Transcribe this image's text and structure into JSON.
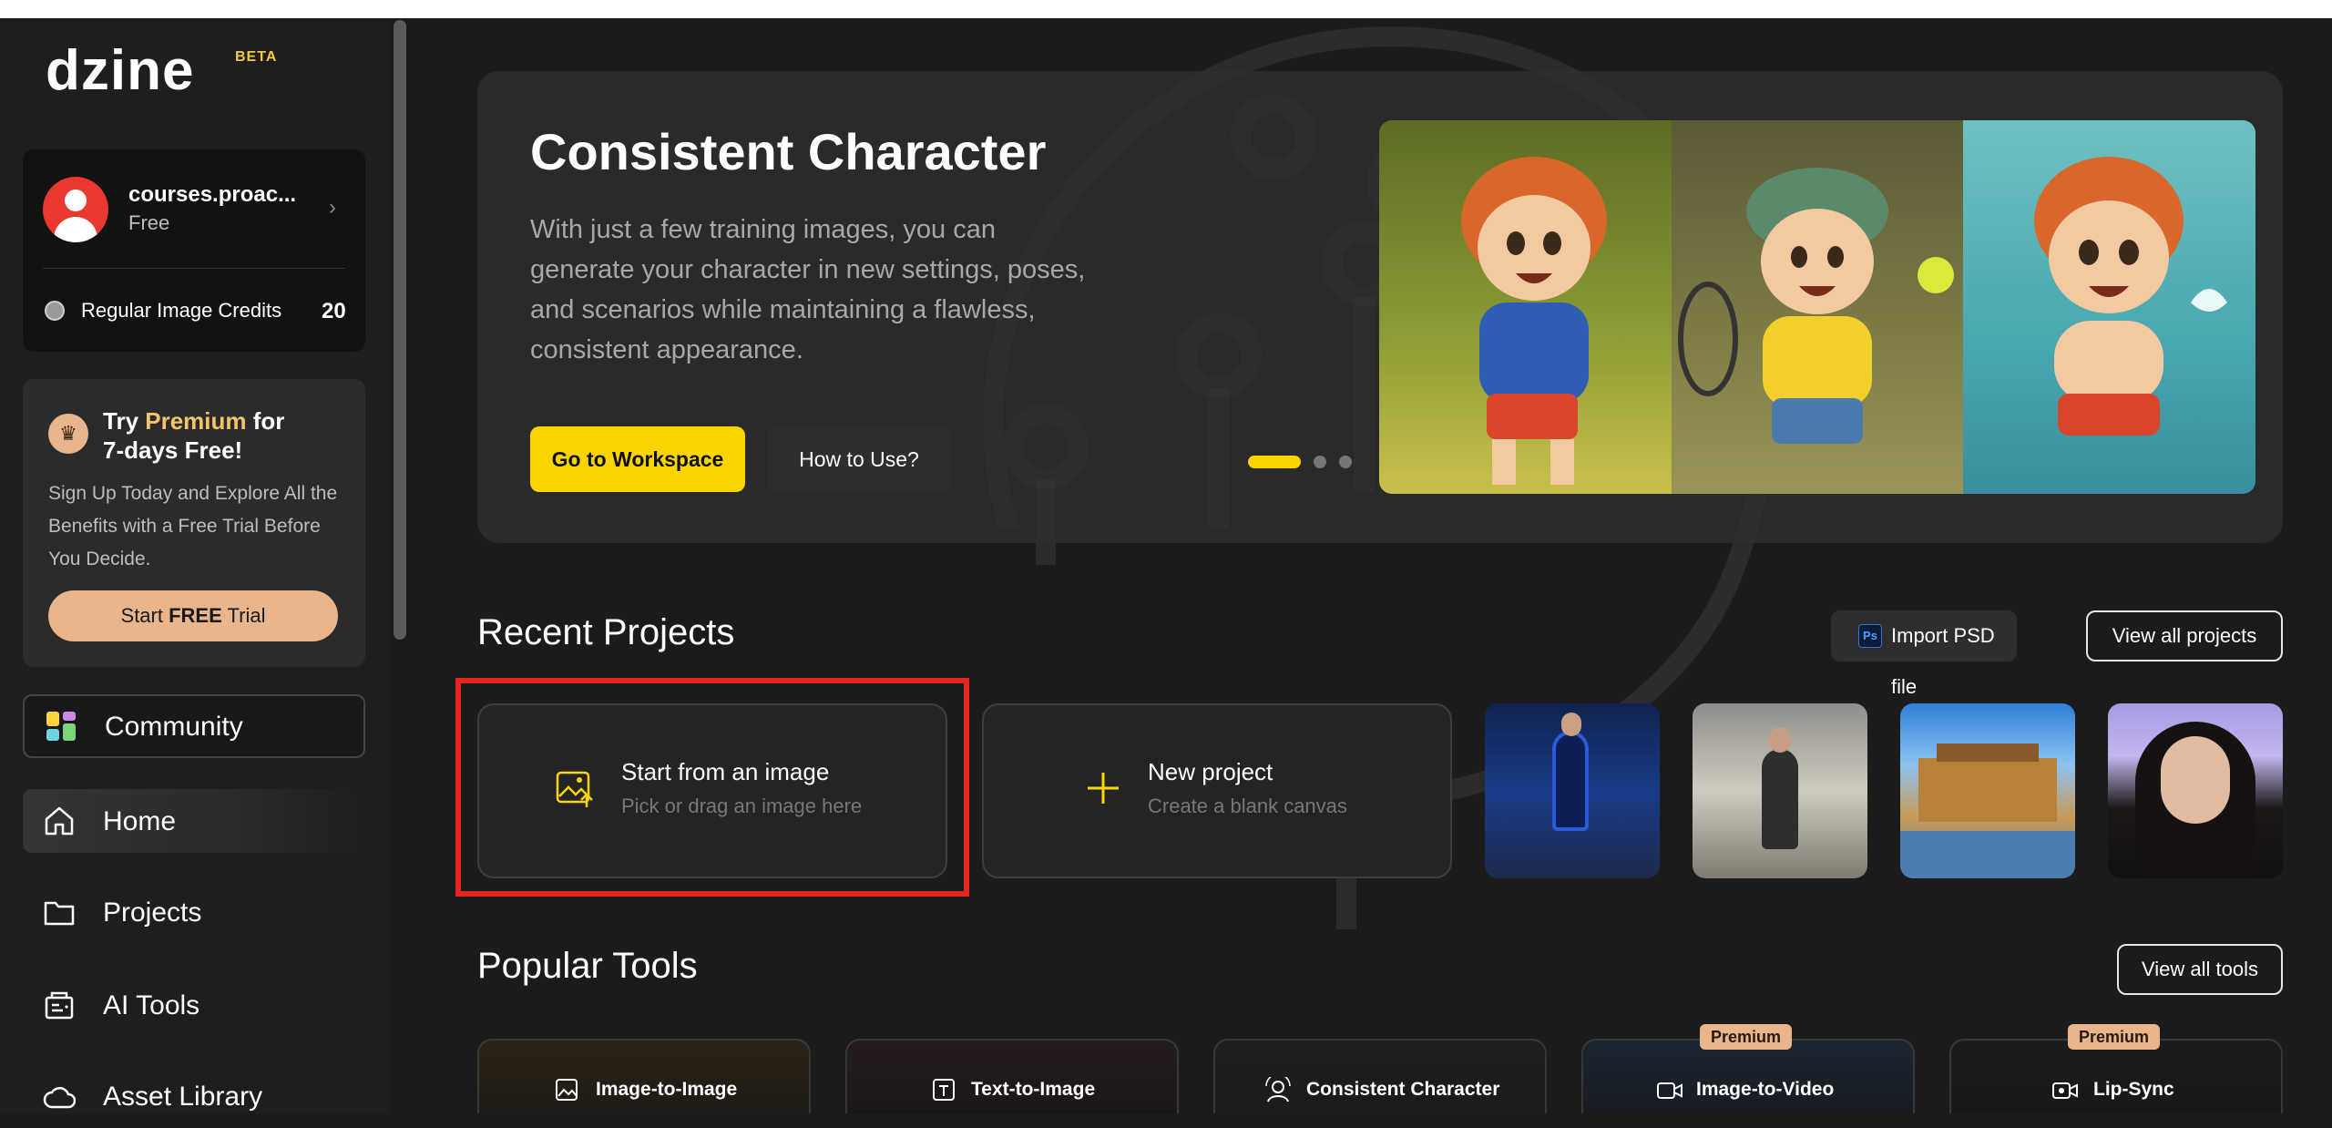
{
  "app": {
    "logo": "dzine",
    "beta": "BETA"
  },
  "user": {
    "name": "courses.proac...",
    "plan": "Free",
    "credits_label": "Regular Image Credits",
    "credits_value": "20"
  },
  "premium": {
    "title_pre": "Try ",
    "title_highlight": "Premium",
    "title_mid": " for",
    "title_line2": "7-days Free!",
    "description": "Sign Up Today and Explore All the Benefits with a Free Trial Before You Decide.",
    "button_pre": "Start ",
    "button_bold": "FREE",
    "button_post": " Trial"
  },
  "nav": {
    "community": "Community",
    "home": "Home",
    "projects": "Projects",
    "ai_tools": "AI Tools",
    "asset_library": "Asset Library"
  },
  "hero": {
    "title": "Consistent Character",
    "description": "With just a few training images, you can generate your character in new settings, poses, and scenarios while maintaining a flawless, consistent appearance.",
    "primary_button": "Go to Workspace",
    "secondary_button": "How to Use?"
  },
  "recent": {
    "title": "Recent Projects",
    "import_psd": "Import PSD file",
    "ps_badge": "Ps",
    "view_all": "View all projects",
    "start_image_title": "Start from an image",
    "start_image_sub": "Pick or drag an image here",
    "new_project_title": "New project",
    "new_project_sub": "Create a blank canvas"
  },
  "tools": {
    "title": "Popular Tools",
    "view_all": "View all tools",
    "items": [
      {
        "label": "Image-to-Image",
        "badge": ""
      },
      {
        "label": "Text-to-Image",
        "badge": ""
      },
      {
        "label": "Consistent Character",
        "badge": ""
      },
      {
        "label": "Image-to-Video",
        "badge": "Premium"
      },
      {
        "label": "Lip-Sync",
        "badge": "Premium"
      }
    ]
  },
  "colors": {
    "accent": "#fcd400",
    "premium": "#e9b58c",
    "highlight_box": "#e3271f",
    "background": "#1b1b1b"
  }
}
